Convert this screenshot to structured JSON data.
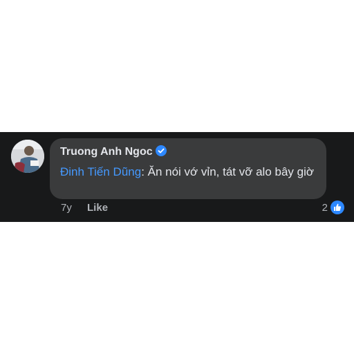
{
  "comment": {
    "author": "Truong Anh Ngoc",
    "mention": "Đinh Tiến Dũng",
    "text": ": Ăn nói vớ vỉn, tát vỡ alo bây giờ",
    "time": "7y",
    "like_label": "Like",
    "reaction_count": "2",
    "verified_icon": "verified-badge-icon",
    "reaction_icon": "thumbs-up-icon"
  },
  "colors": {
    "background": "#18191a",
    "bubble": "#3a3b3c",
    "text": "#e4e6eb",
    "secondary_text": "#b0b3b8",
    "mention": "#4599ff",
    "badge": "#2d88ff"
  }
}
